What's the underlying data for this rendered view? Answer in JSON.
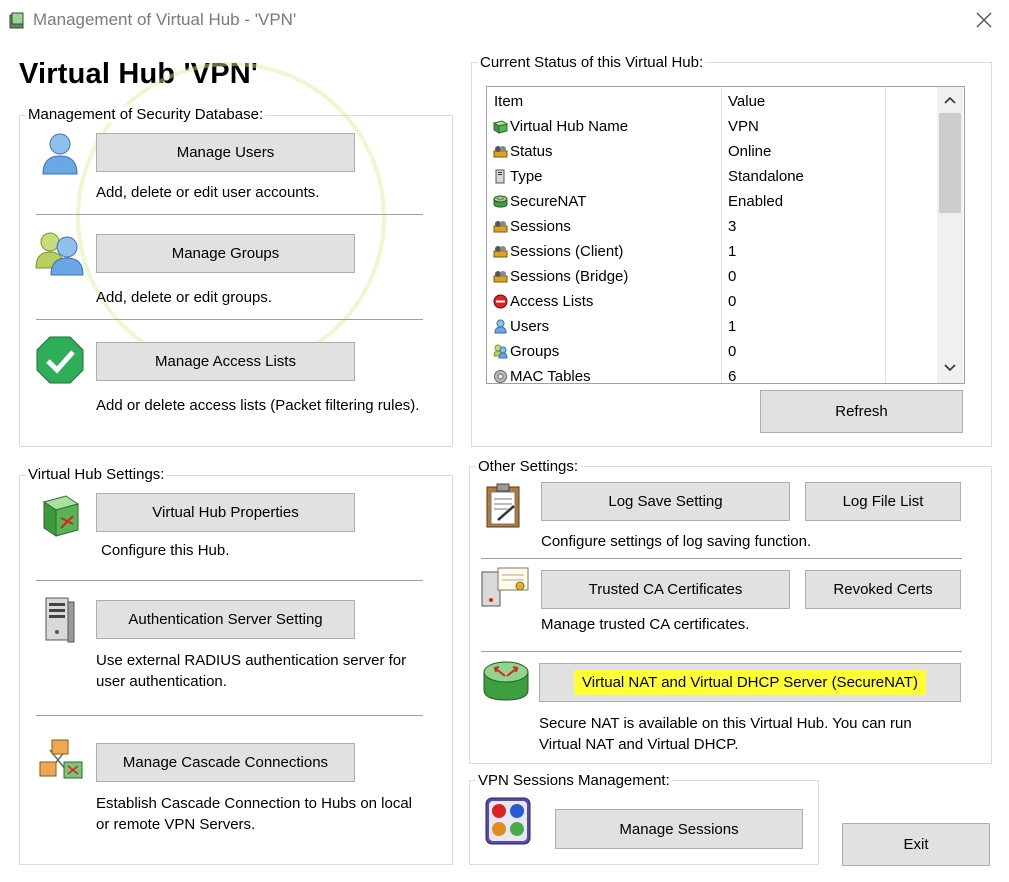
{
  "window": {
    "title": "Management of Virtual Hub - 'VPN'",
    "hub_title": "Virtual Hub 'VPN'",
    "close_icon": "close-icon",
    "app_icon": "vpn-app-icon"
  },
  "security_db": {
    "legend": "Management of Security Database:",
    "manage_users": "Manage Users",
    "manage_users_desc": "Add, delete or edit user accounts.",
    "manage_groups": "Manage Groups",
    "manage_groups_desc": "Add, delete or edit groups.",
    "manage_access": "Manage Access Lists",
    "manage_access_desc": "Add or delete access lists (Packet filtering rules)."
  },
  "hub_settings": {
    "legend": "Virtual Hub Settings:",
    "properties": "Virtual Hub Properties",
    "properties_desc": "Configure this Hub.",
    "auth_server": "Authentication Server Setting",
    "auth_server_desc1": "Use external RADIUS authentication server for",
    "auth_server_desc2": "user authentication.",
    "cascade": "Manage Cascade Connections",
    "cascade_desc1": "Establish Cascade Connection to Hubs on local",
    "cascade_desc2": "or remote VPN Servers."
  },
  "status": {
    "legend": "Current Status of this Virtual Hub:",
    "columns": [
      "Item",
      "Value"
    ],
    "rows": [
      {
        "item": "Virtual Hub Name",
        "value": "VPN",
        "icon": "hub-icon"
      },
      {
        "item": "Status",
        "value": "Online",
        "icon": "status-icon"
      },
      {
        "item": "Type",
        "value": "Standalone",
        "icon": "type-icon"
      },
      {
        "item": "SecureNAT",
        "value": "Enabled",
        "icon": "securenat-icon"
      },
      {
        "item": "Sessions",
        "value": "3",
        "icon": "sessions-icon"
      },
      {
        "item": "Sessions (Client)",
        "value": "1",
        "icon": "sessions-icon"
      },
      {
        "item": "Sessions (Bridge)",
        "value": "0",
        "icon": "sessions-icon"
      },
      {
        "item": "Access Lists",
        "value": "0",
        "icon": "access-list-icon"
      },
      {
        "item": "Users",
        "value": "1",
        "icon": "user-icon"
      },
      {
        "item": "Groups",
        "value": "0",
        "icon": "group-icon"
      },
      {
        "item": "MAC Tables",
        "value": "6",
        "icon": "mac-table-icon"
      }
    ],
    "refresh": "Refresh"
  },
  "other": {
    "legend": "Other Settings:",
    "log_save": "Log Save Setting",
    "log_list": "Log File List",
    "log_desc": "Configure settings of log saving function.",
    "trusted_ca": "Trusted CA Certificates",
    "revoked": "Revoked Certs",
    "ca_desc": "Manage trusted CA certificates.",
    "securenat": "Virtual NAT and Virtual DHCP Server (SecureNAT)",
    "securenat_desc1": "Secure NAT is available on this Virtual Hub. You can run",
    "securenat_desc2": "Virtual NAT and Virtual DHCP."
  },
  "sessions": {
    "legend": "VPN Sessions Management:",
    "manage": "Manage Sessions"
  },
  "exit": "Exit",
  "colors": {
    "highlight": "#ffff33",
    "button_bg": "#e1e1e1",
    "button_border": "#adadad"
  }
}
